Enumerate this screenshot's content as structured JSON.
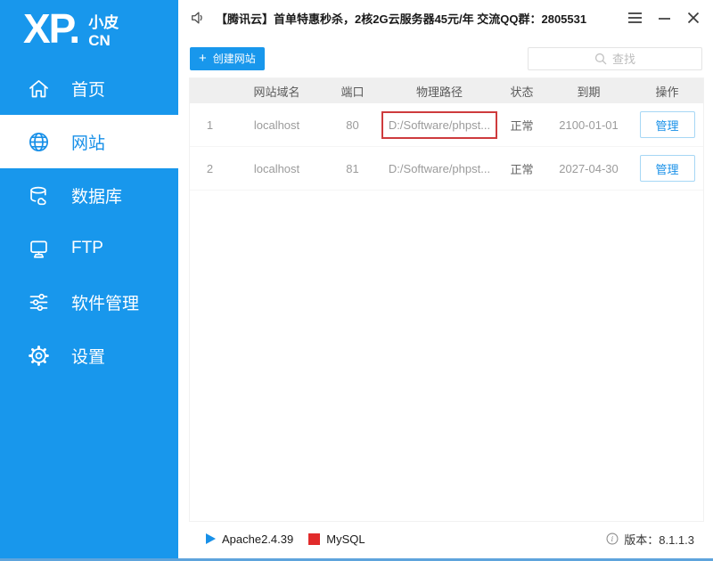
{
  "titlebar": {
    "announcement": "【腾讯云】首单特惠秒杀，2核2G云服务器45元/年 交流QQ群：2805531"
  },
  "sidebar": {
    "logo": {
      "main": "XP.",
      "sub_top": "小皮",
      "sub_bottom": "CN"
    },
    "items": [
      {
        "label": "首页",
        "icon": "home-icon",
        "active": false
      },
      {
        "label": "网站",
        "icon": "globe-icon",
        "active": true
      },
      {
        "label": "数据库",
        "icon": "database-icon",
        "active": false
      },
      {
        "label": "FTP",
        "icon": "ftp-icon",
        "active": false
      },
      {
        "label": "软件管理",
        "icon": "sliders-icon",
        "active": false
      },
      {
        "label": "设置",
        "icon": "gear-icon",
        "active": false
      }
    ]
  },
  "toolbar": {
    "create_button": "创建网站",
    "search_placeholder": "查找"
  },
  "table": {
    "headers": [
      "网站域名",
      "端口",
      "物理路径",
      "状态",
      "到期",
      "操作"
    ],
    "rows": [
      {
        "index": "1",
        "domain": "localhost",
        "port": "80",
        "path": "D:/Software/phpst...",
        "status": "正常",
        "expiry": "2100-01-01",
        "action": "管理",
        "highlighted": true
      },
      {
        "index": "2",
        "domain": "localhost",
        "port": "81",
        "path": "D:/Software/phpst...",
        "status": "正常",
        "expiry": "2027-04-30",
        "action": "管理",
        "highlighted": false
      }
    ]
  },
  "statusbar": {
    "apache": "Apache2.4.39",
    "mysql": "MySQL",
    "version": "版本：8.1.1.3"
  },
  "colors": {
    "brand_blue": "#1897EC",
    "active_blue": "#1890E8",
    "highlight_red": "#CE3B3D",
    "mysql_red": "#E12B2B",
    "header_gray": "#EFEFEF",
    "bottom_border_blue": "#5EA4DC"
  }
}
